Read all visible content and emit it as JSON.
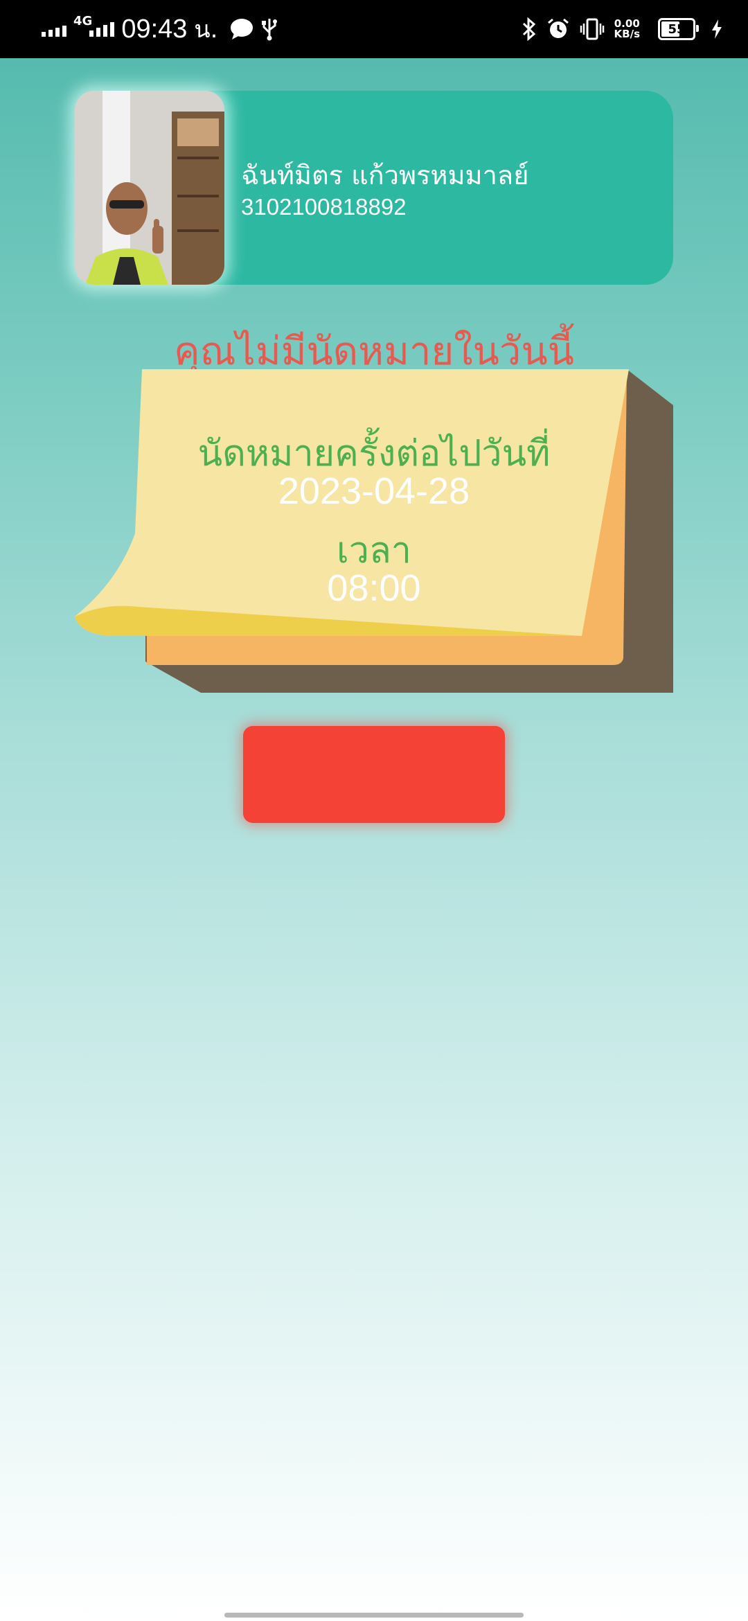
{
  "status_bar": {
    "network_type": "4G",
    "time": "09:43",
    "time_suffix": "น.",
    "data_speed_value": "0.00",
    "data_speed_unit": "KB/s",
    "battery_level": "55",
    "icons": [
      "signal-icon",
      "chat-bubble-icon",
      "usb-icon",
      "bluetooth-icon",
      "alarm-icon",
      "vibrate-icon",
      "battery-icon",
      "charging-icon"
    ]
  },
  "profile": {
    "name": "ฉันท์มิตร  แก้วพรหมมาลย์",
    "id_number": "3102100818892"
  },
  "message": {
    "no_appointment_today": "คุณไม่มีนัดหมายในวันนี้"
  },
  "appointment": {
    "next_label": "นัดหมายครั้งต่อไปวันที่",
    "date": "2023-04-28",
    "time_label": "เวลา",
    "time": "08:00"
  },
  "action_button": {
    "label": ""
  },
  "colors": {
    "card": "#2db8a2",
    "heading": "#e85a4f",
    "label_green": "#4caf50",
    "button": "#f44336",
    "note_yellow": "#f7e6a3",
    "note_orange": "#f6b563",
    "note_shadow": "#6e5e4c"
  }
}
